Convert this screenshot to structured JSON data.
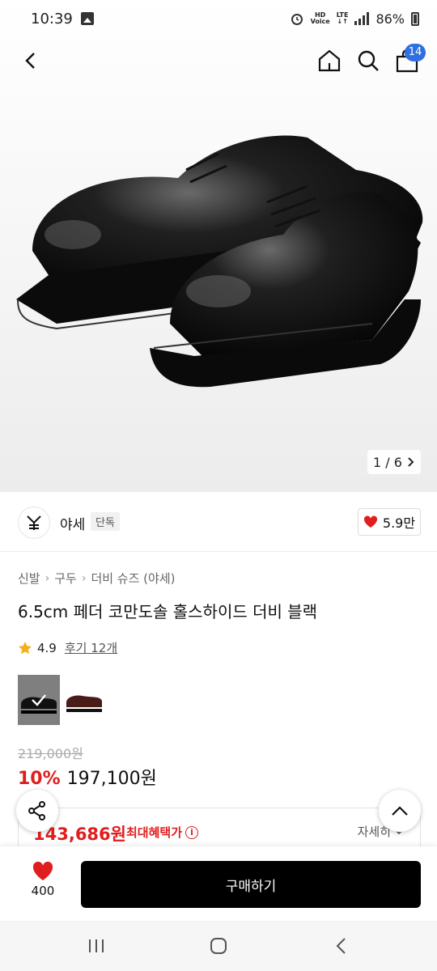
{
  "status_bar": {
    "time": "10:39",
    "indicator_hd": "HD",
    "indicator_voice": "Voice",
    "indicator_lte": "LTE",
    "battery_percent": "86%"
  },
  "top_nav": {
    "cart_count": "14",
    "icons": [
      "back-icon",
      "home-icon",
      "search-icon",
      "cart-icon"
    ]
  },
  "gallery": {
    "page_indicator": "1 / 6"
  },
  "brand": {
    "name": "야세",
    "tag": "단독",
    "like_count": "5.9만"
  },
  "breadcrumb": [
    "신발",
    "구두",
    "더비 슈즈 (야세)"
  ],
  "product": {
    "title": "6.5cm 페더 코만도솔 홀스하이드 더비 블랙",
    "rating": "4.9",
    "review_label": "후기 12개"
  },
  "pricing": {
    "original_price": "219,000원",
    "discount_rate": "10%",
    "sale_price": "197,100원",
    "max_benefit_price": "143,686원",
    "max_benefit_label": "최대혜택가",
    "detail_label": "자세히"
  },
  "action_bar": {
    "wish_count": "400",
    "buy_label": "구매하기"
  },
  "colors": {
    "accent_red": "#e01e1e",
    "badge_blue": "#2f6fe0",
    "button_black": "#000000"
  }
}
